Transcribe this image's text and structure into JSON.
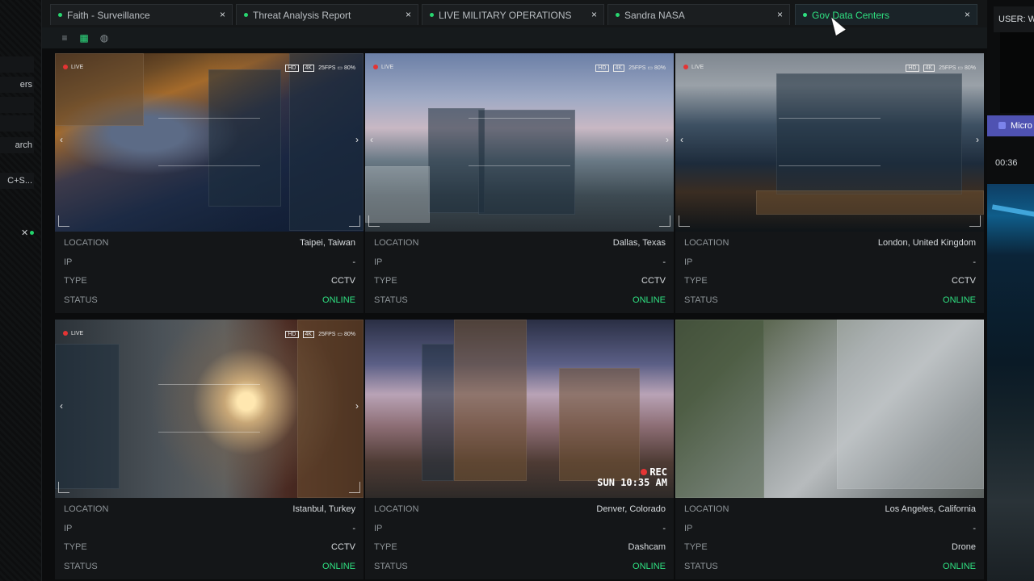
{
  "left_strip": {
    "items": [
      "",
      "ers",
      "",
      "",
      "arch",
      "C+S..."
    ],
    "close": "✕"
  },
  "tabs": [
    {
      "label": "Faith - Surveillance",
      "active": false
    },
    {
      "label": "Threat Analysis Report",
      "active": false
    },
    {
      "label": "LIVE MILITARY OPERATIONS",
      "active": false
    },
    {
      "label": "Sandra NASA",
      "active": false
    },
    {
      "label": "Gov Data Centers",
      "active": true
    }
  ],
  "tab_close": "×",
  "toolbar": {
    "icons": [
      "list-view-icon",
      "grid-view-icon",
      "globe-icon"
    ]
  },
  "right_strip": {
    "user_label": "USER: W",
    "teams_label": "Micro",
    "time": "00:36"
  },
  "overlay": {
    "live": "LIVE",
    "hd": "HD",
    "k4": "4K",
    "fps": "25FPS",
    "battery": "80%"
  },
  "labels": {
    "location": "LOCATION",
    "ip": "IP",
    "type": "TYPE",
    "status": "STATUS"
  },
  "cameras": [
    {
      "location": "Taipei, Taiwan",
      "ip": "-",
      "type": "CCTV",
      "status": "ONLINE"
    },
    {
      "location": "Dallas, Texas",
      "ip": "-",
      "type": "CCTV",
      "status": "ONLINE"
    },
    {
      "location": "London, United Kingdom",
      "ip": "-",
      "type": "CCTV",
      "status": "ONLINE"
    },
    {
      "location": "Istanbul, Turkey",
      "ip": "-",
      "type": "CCTV",
      "status": "ONLINE"
    },
    {
      "location": "Denver, Colorado",
      "ip": "-",
      "type": "Dashcam",
      "status": "ONLINE"
    },
    {
      "location": "Los Angeles, California",
      "ip": "-",
      "type": "Drone",
      "status": "ONLINE"
    }
  ],
  "dashcam": {
    "rec": "REC",
    "timestamp": "SUN 10:35 AM"
  },
  "colors": {
    "accent": "#2fe081",
    "live_red": "#e43434",
    "teams": "#4f52b2"
  }
}
